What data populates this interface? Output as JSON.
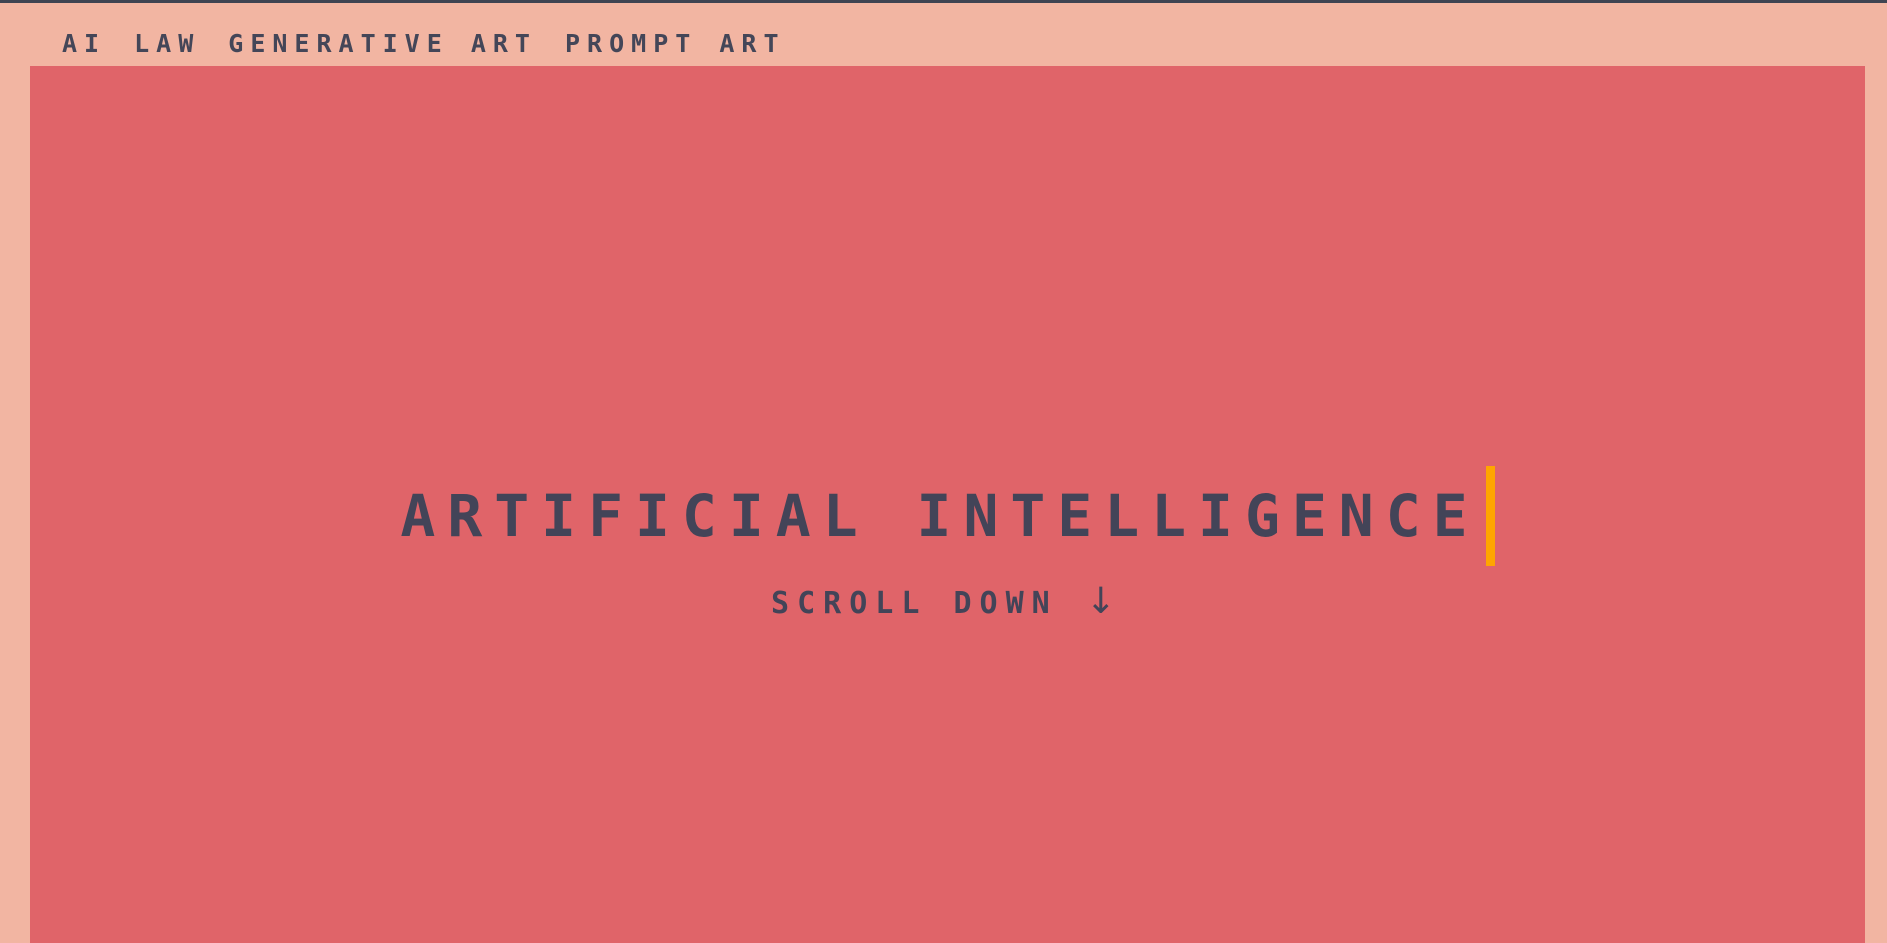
{
  "nav": {
    "items": [
      {
        "label": "AI"
      },
      {
        "label": "LAW"
      },
      {
        "label": "GENERATIVE ART"
      },
      {
        "label": "PROMPT ART"
      }
    ]
  },
  "hero": {
    "headline": "ARTIFICIAL INTELLIGENCE",
    "scroll_label": "SCROLL DOWN",
    "scroll_arrow": "↓"
  },
  "colors": {
    "page_background": "#F2B5A2",
    "hero_background": "#E06469",
    "text": "#434458",
    "cursor": "#FFA500"
  }
}
